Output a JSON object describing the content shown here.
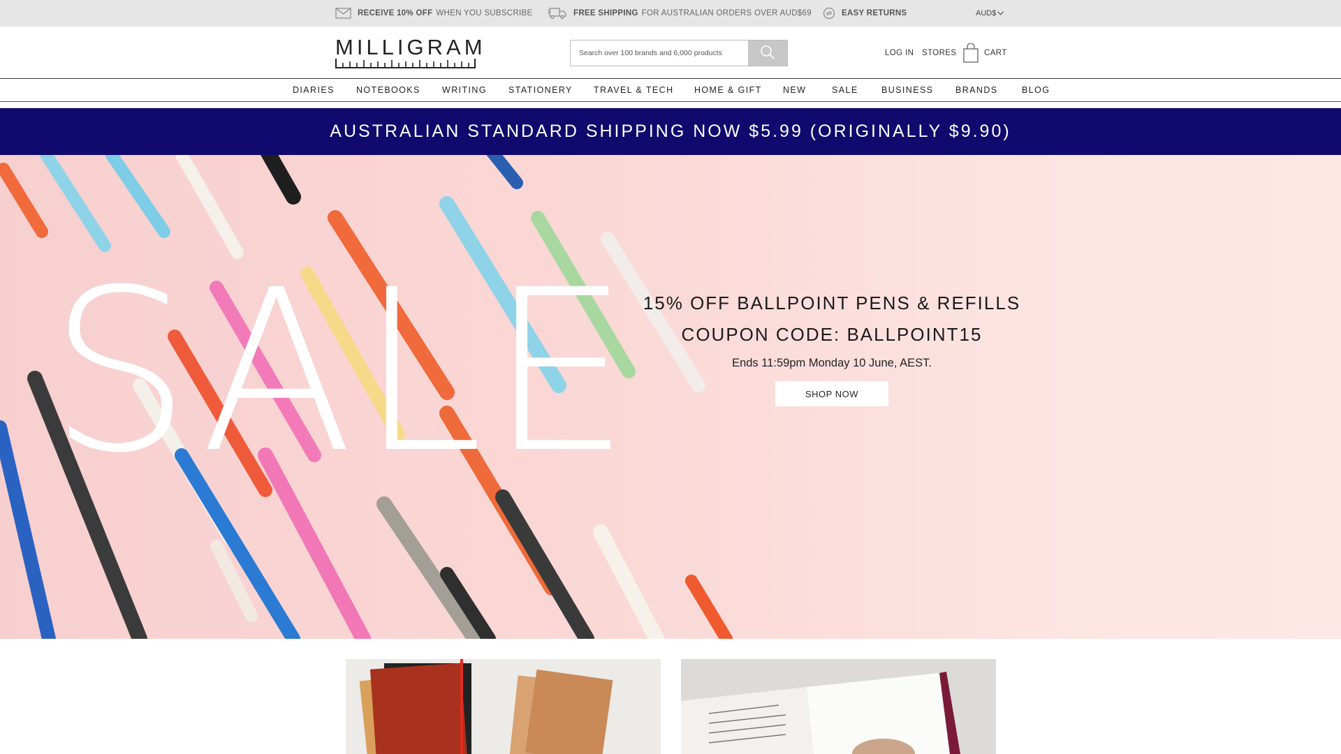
{
  "promo_strip": {
    "items": [
      {
        "icon": "envelope-icon",
        "bold": "RECEIVE 10% OFF",
        "text": "WHEN YOU SUBSCRIBE"
      },
      {
        "icon": "truck-icon",
        "bold": "FREE SHIPPING",
        "text": "FOR AUSTRALIAN ORDERS OVER AUD$69"
      },
      {
        "icon": "return-icon",
        "bold": "EASY RETURNS",
        "text": ""
      }
    ],
    "currency": "AUD$"
  },
  "header": {
    "logo_text": "MILLIGRAM",
    "search_placeholder": "Search over 100 brands and 6,000 products",
    "login": "LOG IN",
    "stores": "STORES",
    "cart": "CART"
  },
  "nav": {
    "items": [
      "DIARIES",
      "NOTEBOOKS",
      "WRITING",
      "STATIONERY",
      "TRAVEL & TECH",
      "HOME & GIFT",
      "NEW",
      "SALE",
      "BUSINESS",
      "BRANDS",
      "BLOG"
    ]
  },
  "banner": {
    "text": "AUSTRALIAN STANDARD SHIPPING NOW $5.99 (ORIGINALLY $9.90)",
    "background": "#100a6e"
  },
  "hero": {
    "sale_word": "SALE",
    "title_line1": "15% OFF BALLPOINT PENS & REFILLS",
    "title_line2": "COUPON CODE: BALLPOINT15",
    "subtitle": "Ends 11:59pm Monday 10 June, AEST.",
    "cta": "SHOP NOW"
  }
}
